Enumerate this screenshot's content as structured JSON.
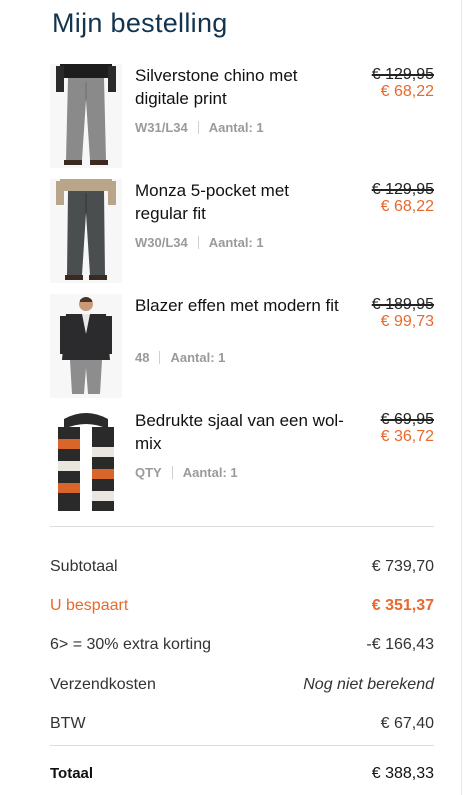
{
  "title": "Mijn bestelling",
  "items": [
    {
      "name": "Silverstone chino met digitale print",
      "size": "W31/L34",
      "quantity": "Aantal: 1",
      "old_price": "€ 129,95",
      "new_price": "€ 68,22",
      "image": "grey-chino-pants"
    },
    {
      "name": "Monza 5-pocket met regular fit",
      "size": "W30/L34",
      "quantity": "Aantal: 1",
      "old_price": "€ 129,95",
      "new_price": "€ 68,22",
      "image": "dark-grey-5-pocket-pants"
    },
    {
      "name": "Blazer effen met modern fit",
      "size": "48",
      "quantity": "Aantal: 1",
      "old_price": "€ 189,95",
      "new_price": "€ 99,73",
      "image": "dark-blazer"
    },
    {
      "name": "Bedrukte sjaal van een wol-mix",
      "size": "QTY",
      "quantity": "Aantal: 1",
      "old_price": "€ 69,95",
      "new_price": "€ 36,72",
      "image": "printed-wool-scarf"
    }
  ],
  "summary": {
    "subtotal_label": "Subtotaal",
    "subtotal_value": "€ 739,70",
    "savings_label": "U bespaart",
    "savings_value": "€ 351,37",
    "discount_label": "6> = 30% extra korting",
    "discount_value": "-€ 166,43",
    "shipping_label": "Verzendkosten",
    "shipping_value": "Nog niet berekend",
    "vat_label": "BTW",
    "vat_value": "€ 67,40",
    "total_label": "Totaal",
    "total_value": "€ 388,33"
  },
  "colors": {
    "accent": "#e8692c",
    "title": "#13344f"
  }
}
